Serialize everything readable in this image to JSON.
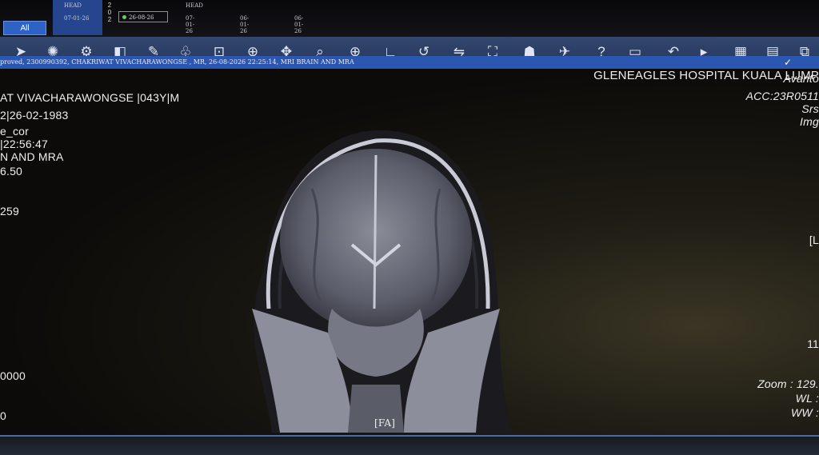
{
  "series_bar": {
    "all_button": "All",
    "selected": {
      "label": "HEAD",
      "date": "07-01-26"
    },
    "year": "2\n0\n2",
    "current": {
      "date": "26-08-26"
    },
    "thumbs": [
      {
        "label": "HEAD",
        "date": "07-01-26"
      },
      {
        "label": "",
        "date": "06-01-26"
      },
      {
        "label": "",
        "date": "06-01-26"
      }
    ]
  },
  "toolbar": {
    "tools": [
      {
        "name": "pointer-icon",
        "glyph": "➤"
      },
      {
        "name": "brightness-icon",
        "glyph": "✺"
      },
      {
        "name": "settings-gear-icon",
        "glyph": "⚙"
      },
      {
        "name": "invert-icon",
        "glyph": "◧"
      },
      {
        "name": "annotate-pencil-icon",
        "glyph": "✎"
      },
      {
        "name": "lungs-preset-icon",
        "glyph": "♧"
      },
      {
        "name": "roi-edit-icon",
        "glyph": "⊡"
      },
      {
        "name": "crosshair-icon",
        "glyph": "⊕"
      },
      {
        "name": "pan-icon",
        "glyph": "✥"
      },
      {
        "name": "magnifier-icon",
        "glyph": "⌕"
      },
      {
        "name": "zoom-in-icon",
        "glyph": "⊕"
      },
      {
        "name": "angle-measure-icon",
        "glyph": "∟"
      },
      {
        "name": "rotate-icon",
        "glyph": "↺"
      },
      {
        "name": "flip-icon",
        "glyph": "⇋"
      },
      {
        "name": "fit-screen-icon",
        "glyph": "⛶"
      },
      {
        "name": "user-icon",
        "glyph": "☗"
      },
      {
        "name": "export-icon",
        "glyph": "✈"
      },
      {
        "name": "help-icon",
        "glyph": "?"
      },
      {
        "name": "layout-icon",
        "glyph": "▭"
      },
      {
        "name": "undo-icon",
        "glyph": "↶"
      },
      {
        "name": "next-icon",
        "glyph": "▸"
      },
      {
        "name": "grid-layout-icon",
        "glyph": "▦"
      },
      {
        "name": "pdf-report-icon",
        "glyph": "▤"
      },
      {
        "name": "close-window-icon",
        "glyph": "⧉"
      }
    ],
    "filter_icon": "✓"
  },
  "info_bar": {
    "text": "proved, 2300990392, CHAKRIWAT VIVACHARAWONGSE , MR, 26-08-2026 22:25:14, MRI BRAIN AND MRA"
  },
  "overlay": {
    "left": [
      {
        "text": "AT VIVACHARAWONGSE |043Y|M"
      },
      {
        "text": "2|26-02-1983"
      },
      {
        "text": "e_cor"
      },
      {
        "text": "|22:56:47"
      },
      {
        "text": "N AND MRA"
      },
      {
        "text": "6.50"
      },
      {
        "text": "259"
      },
      {
        "text": "0000"
      },
      {
        "text": "0"
      }
    ],
    "right": [
      {
        "text": "GLENEAGLES HOSPITAL KUALA LUMP"
      },
      {
        "text": "Avanto"
      },
      {
        "text": "ACC:23R0511"
      },
      {
        "text": "Srs"
      },
      {
        "text": "Img"
      },
      {
        "text": "[L"
      },
      {
        "text": "11"
      },
      {
        "text": "Zoom : 129."
      },
      {
        "text": "WL :"
      },
      {
        "text": "WW :"
      }
    ],
    "orientation_bottom": "[FA]"
  },
  "colors": {
    "toolbar": "#2b3d63",
    "info_bar": "#2c57b0",
    "selected_series": "#26458f",
    "overlay_text": "#eeeeee"
  }
}
